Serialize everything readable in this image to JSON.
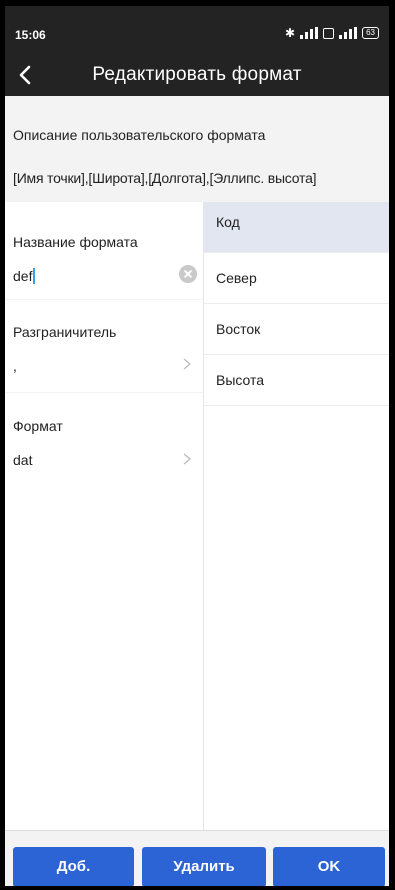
{
  "status_bar": {
    "time": "15:06",
    "battery": "63"
  },
  "header": {
    "title": "Редактировать формат"
  },
  "description": {
    "label": "Описание пользовательского формата",
    "value": "[Имя точки],[Широта],[Долгота],[Эллипс. высота]"
  },
  "fields": {
    "name": {
      "label": "Название формата",
      "value": "def"
    },
    "delimiter": {
      "label": "Разграничитель",
      "value": ","
    },
    "format": {
      "label": "Формат",
      "value": "dat"
    }
  },
  "columns": [
    "Код",
    "Север",
    "Восток",
    "Высота"
  ],
  "buttons": {
    "add": "Доб.",
    "delete": "Удалить",
    "ok": "OK"
  },
  "colors": {
    "accent": "#2c63d5",
    "selected_row": "#e1e6f1",
    "header_bg": "#232323"
  }
}
